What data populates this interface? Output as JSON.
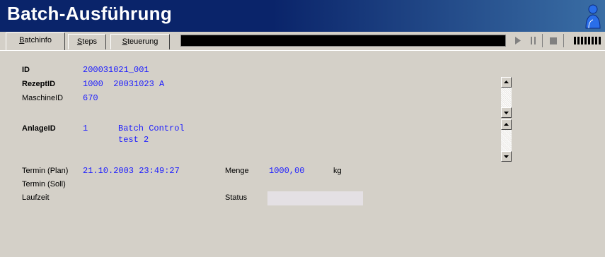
{
  "window": {
    "title": "Batch-Ausführung"
  },
  "tabs": [
    {
      "label": "Batchinfo",
      "mnemonic": "B",
      "rest": "atchinfo",
      "active": true
    },
    {
      "label": "Steps",
      "mnemonic": "S",
      "rest": "teps",
      "active": false
    },
    {
      "label": "Steuerung",
      "mnemonic": "S",
      "rest": "teuerung",
      "active": false
    }
  ],
  "controls": [
    "play-icon",
    "pause-icon",
    "stop-icon",
    "bars-icon"
  ],
  "batchinfo": {
    "id_label": "ID",
    "id_value": "200031021_001",
    "rezept_label": "RezeptID",
    "rezept_value": "1000  20031023 A",
    "maschine_label": "MaschineID",
    "maschine_value": "670",
    "anlage_label": "AnlageID",
    "anlage_value": "1",
    "anlage_name_line1": "Batch Control",
    "anlage_name_line2": "test 2",
    "termin_plan_label": "Termin (Plan)",
    "termin_plan_value": "21.10.2003 23:49:27",
    "termin_soll_label": "Termin (Soll)",
    "laufzeit_label": "Laufzeit",
    "menge_label": "Menge",
    "menge_value": "1000,00",
    "menge_unit": "kg",
    "status_label": "Status",
    "status_value": ""
  },
  "colors": {
    "title_bg": "#0a246a",
    "value_text": "#1b1bff",
    "panel_bg": "#d4d0c8"
  }
}
